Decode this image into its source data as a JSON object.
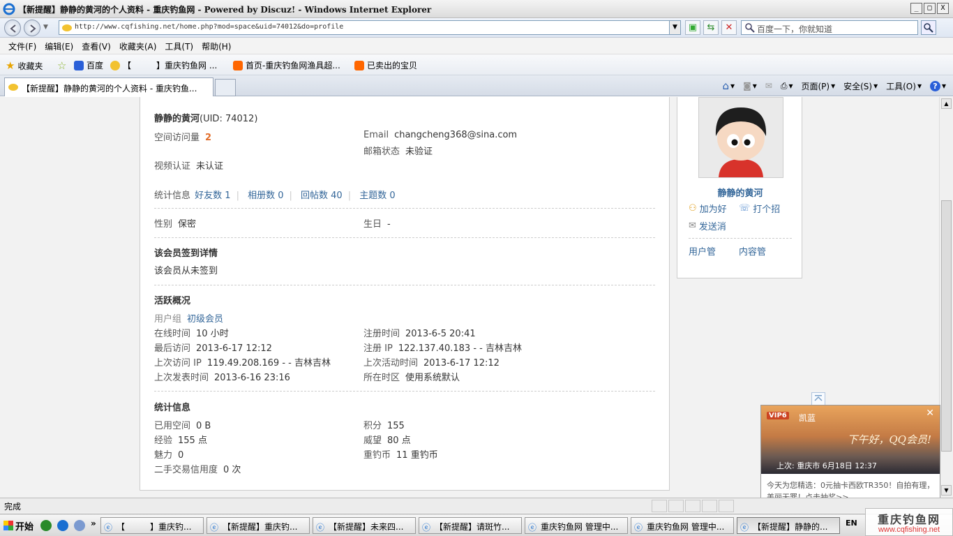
{
  "window": {
    "title": "【新提醒】静静的黄河的个人资料 - 重庆钓鱼网 - Powered by Discuz! - Windows Internet Explorer",
    "min": "_",
    "max": "□",
    "close": "X"
  },
  "address": {
    "url": "http://www.cqfishing.net/home.php?mod=space&uid=74012&do=profile",
    "search_placeholder": "百度一下，你就知道"
  },
  "menu": [
    "文件(F)",
    "编辑(E)",
    "查看(V)",
    "收藏夹(A)",
    "工具(T)",
    "帮助(H)"
  ],
  "favorites": {
    "label": "收藏夹",
    "items": [
      "百度",
      "【　　　】重庆钓鱼网 ...",
      "首页-重庆钓鱼网渔具超...",
      "已卖出的宝贝"
    ]
  },
  "tab": {
    "title": "【新提醒】静静的黄河的个人资料 - 重庆钓鱼..."
  },
  "commands": {
    "page": "页面(P)",
    "safety": "安全(S)",
    "tools": "工具(O)"
  },
  "profile": {
    "name": "静静的黄河",
    "uid": "(UID: 74012)",
    "visits_label": "空间访问量",
    "visits": "2",
    "email_label": "Email",
    "email": "changcheng368@sina.com",
    "email_status_label": "邮箱状态",
    "email_status": "未验证",
    "video_label": "视频认证",
    "video": "未认证",
    "stats_label": "统计信息",
    "stats": [
      "好友数 1",
      "相册数 0",
      "回帖数 40",
      "主题数 0"
    ],
    "gender_label": "性别",
    "gender": "保密",
    "birthday_label": "生日",
    "birthday": "-",
    "signin_title": "该会员签到详情",
    "signin_text": "该会员从未签到",
    "activity_title": "活跃概况",
    "group_label": "用户组",
    "group": "初级会员",
    "online_label": "在线时间",
    "online": "10 小时",
    "reg_time_label": "注册时间",
    "reg_time": "2013-6-5 20:41",
    "last_visit_label": "最后访问",
    "last_visit": "2013-6-17 12:12",
    "reg_ip_label": "注册 IP",
    "reg_ip": "122.137.40.183 - - 吉林吉林",
    "last_ip_label": "上次访问 IP",
    "last_ip": "119.49.208.169 - - 吉林吉林",
    "last_active_label": "上次活动时间",
    "last_active": "2013-6-17 12:12",
    "last_post_label": "上次发表时间",
    "last_post": "2013-6-16 23:16",
    "timezone_label": "所在时区",
    "timezone": "使用系统默认",
    "stat_title": "统计信息",
    "used_space_label": "已用空间",
    "used_space": "0 B",
    "points_label": "积分",
    "points": "155",
    "exp_label": "经验",
    "exp": "155 点",
    "prestige_label": "威望",
    "prestige": "80 点",
    "charm_label": "魅力",
    "charm": "0",
    "coin_label": "重钓币",
    "coin": "11 重钓币",
    "trade_label": "二手交易信用度",
    "trade": "0 次"
  },
  "side": {
    "name": "静静的黄河",
    "add_friend": "加为好",
    "poke": "打个招",
    "send_msg": "发送消",
    "user_manage": "用户管",
    "content_manage": "内容管"
  },
  "qq": {
    "vip": "VIP6",
    "user": "凯蓝",
    "greeting": "下午好，QQ会员!",
    "last_login": "上次: 重庆市  6月18日 12:37",
    "text": "今天为您精选：0元抽卡西欧TR350！自拍有理，美丽无罪！点击抽奖>>"
  },
  "status": {
    "text": "完成"
  },
  "taskbar": {
    "start": "开始",
    "buttons": [
      "【　　　】重庆钓...",
      "【新提醒】重庆钓...",
      "【新提醒】未来四...",
      "【新提醒】请斑竹...",
      "重庆钓鱼网 管理中...",
      "重庆钓鱼网 管理中...",
      "【新提醒】静静的..."
    ],
    "tray": "EN"
  },
  "watermark": {
    "line1": "重庆钓鱼网",
    "line2": "www.cqfishing.net"
  }
}
